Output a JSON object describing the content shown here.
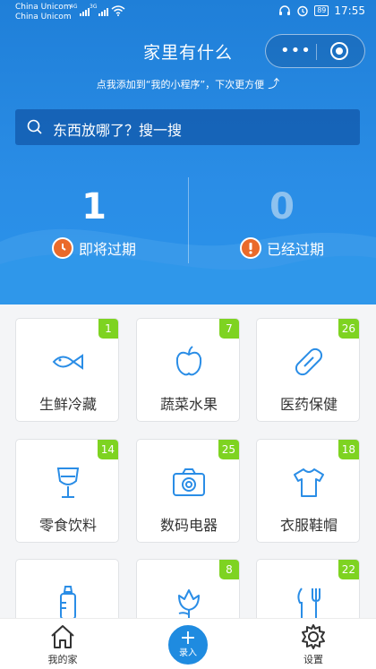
{
  "status_bar": {
    "carrier_1": "China Unicom",
    "carrier_2": "China Unicom",
    "net_1": "4G",
    "net_2": "3G",
    "battery": "89",
    "time": "17:55"
  },
  "nav": {
    "title": "家里有什么",
    "more_icon": "more-dots-icon",
    "close_icon": "target-icon"
  },
  "hint": "点我添加到“我的小程序”，下次更方便",
  "search": {
    "placeholder": "东西放哪了？搜一搜",
    "icon": "search-icon"
  },
  "stats": {
    "expiring": {
      "count": "1",
      "label": "即将过期",
      "icon": "clock-icon",
      "color": "#ea6a2a"
    },
    "expired": {
      "count": "0",
      "label": "已经过期",
      "icon": "exclamation-icon",
      "color": "#ea6a2a"
    }
  },
  "categories": [
    {
      "name": "生鲜冷藏",
      "count": "1",
      "icon": "fish-icon"
    },
    {
      "name": "蔬菜水果",
      "count": "7",
      "icon": "apple-icon"
    },
    {
      "name": "医药保健",
      "count": "26",
      "icon": "pill-icon"
    },
    {
      "name": "零食饮料",
      "count": "14",
      "icon": "wine-glass-icon"
    },
    {
      "name": "数码电器",
      "count": "25",
      "icon": "camera-icon"
    },
    {
      "name": "衣服鞋帽",
      "count": "18",
      "icon": "tshirt-icon"
    },
    {
      "name": "",
      "count": "",
      "icon": "baby-bottle-icon"
    },
    {
      "name": "",
      "count": "8",
      "icon": "flower-icon"
    },
    {
      "name": "",
      "count": "22",
      "icon": "cutlery-icon"
    }
  ],
  "tabbar": {
    "home": "我的家",
    "add": "录入",
    "settings": "设置"
  },
  "colors": {
    "primary": "#1f7fd8",
    "badge": "#7ed321",
    "icon": "#2a8de6",
    "alert": "#ea6a2a"
  }
}
